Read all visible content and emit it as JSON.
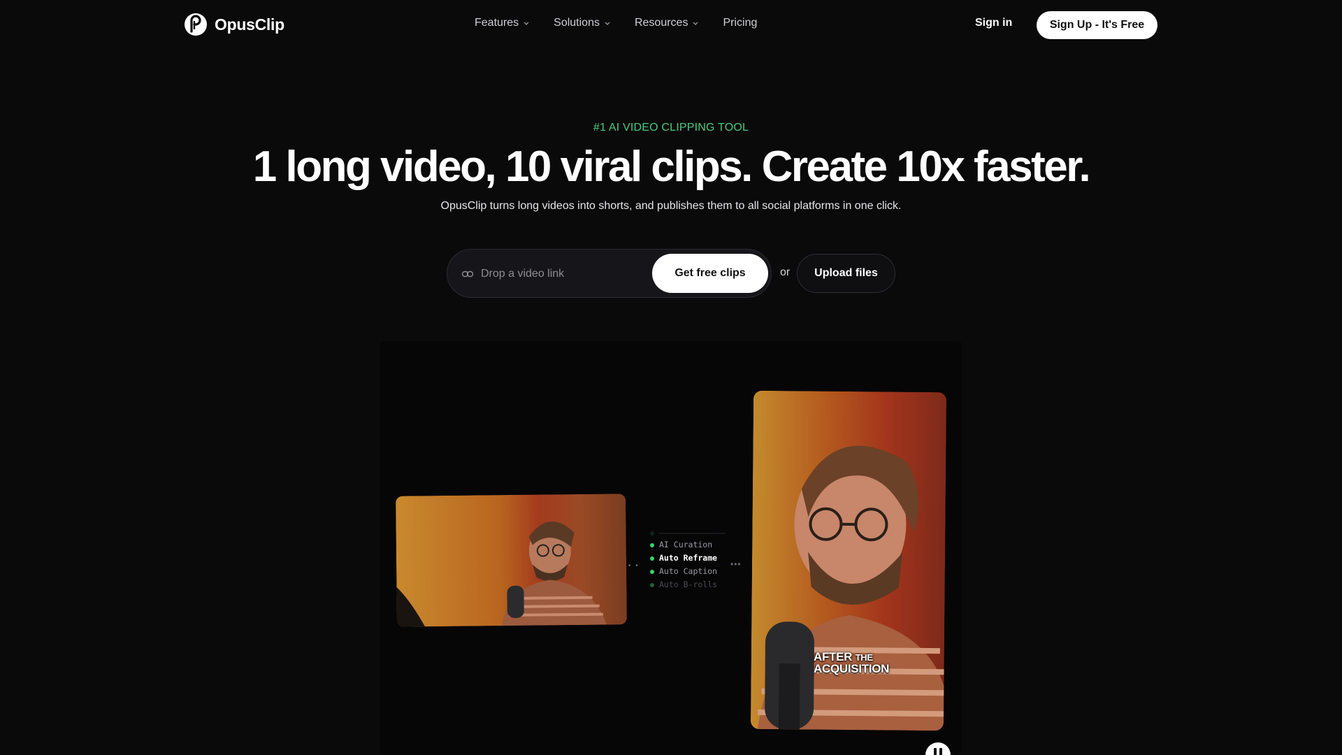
{
  "nav": {
    "brand": "OpusClip",
    "links": [
      {
        "label": "Features",
        "has_dropdown": true
      },
      {
        "label": "Solutions",
        "has_dropdown": true
      },
      {
        "label": "Resources",
        "has_dropdown": true
      },
      {
        "label": "Pricing",
        "has_dropdown": false
      }
    ],
    "signin": "Sign in",
    "signup": "Sign Up - It's Free"
  },
  "hero": {
    "eyebrow": "#1 AI VIDEO CLIPPING TOOL",
    "headline": "1 long video, 10 viral clips. Create 10x faster.",
    "subheadline": "OpusClip turns long videos into shorts, and publishes them to all social platforms in one click.",
    "input_placeholder": "Drop a video link",
    "cta": "Get free clips",
    "or": "or",
    "upload": "Upload files"
  },
  "showcase": {
    "features": [
      "AI Curation",
      "Auto Reframe",
      "Auto Caption",
      "Auto B-rolls"
    ],
    "active_feature": "Auto Reframe",
    "caption_line1_big": "AFTER",
    "caption_line1_small": "THE",
    "caption_line2": "ACQUISITION"
  },
  "colors": {
    "background": "#0a0a0b",
    "accent_green": "#4ec97a",
    "button_bg": "#ffffff"
  },
  "icons": {
    "logo": "opusclip-logo-icon",
    "link": "link-icon",
    "chevron": "chevron-down-icon",
    "pause": "pause-icon"
  }
}
